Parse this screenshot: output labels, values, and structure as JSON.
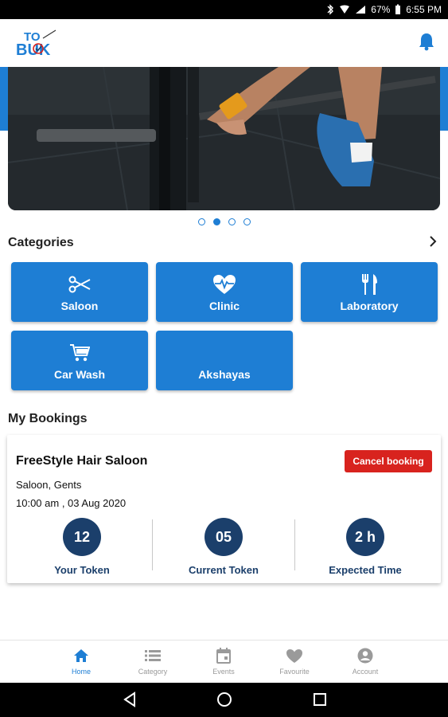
{
  "status_bar": {
    "battery": "67%",
    "time": "6:55 PM"
  },
  "app": {
    "logo_text_top": "TO",
    "logo_text_bottom": "BUK"
  },
  "banner": {
    "image": "barbell-deadlift-photo",
    "slides": 4,
    "active_slide": 2
  },
  "categories": {
    "title": "Categories",
    "items": [
      {
        "label": "Saloon",
        "icon": "scissors-icon"
      },
      {
        "label": "Clinic",
        "icon": "heart-pulse-icon"
      },
      {
        "label": "Laboratory",
        "icon": "fork-knife-icon"
      },
      {
        "label": "Car Wash",
        "icon": "cart-icon"
      },
      {
        "label": "Akshayas",
        "icon": ""
      }
    ]
  },
  "bookings": {
    "title": "My Bookings",
    "card": {
      "shop_name": "FreeStyle Hair Saloon",
      "category": "Saloon, Gents",
      "datetime": "10:00 am , 03 Aug 2020",
      "cancel_label": "Cancel booking",
      "your_token": {
        "value": "12",
        "label": "Your Token"
      },
      "current_token": {
        "value": "05",
        "label": "Current Token"
      },
      "expected_time": {
        "value": "2 h",
        "label": "Expected Time"
      }
    }
  },
  "bottom_nav": [
    {
      "label": "Home",
      "icon": "home-icon",
      "active": true
    },
    {
      "label": "Category",
      "icon": "list-icon",
      "active": false
    },
    {
      "label": "Events",
      "icon": "calendar-icon",
      "active": false
    },
    {
      "label": "Favourite",
      "icon": "heart-icon",
      "active": false
    },
    {
      "label": "Account",
      "icon": "account-icon",
      "active": false
    }
  ],
  "colors": {
    "primary": "#1e7ed4",
    "dark_blue": "#1b3f6b",
    "danger": "#d8231e"
  }
}
